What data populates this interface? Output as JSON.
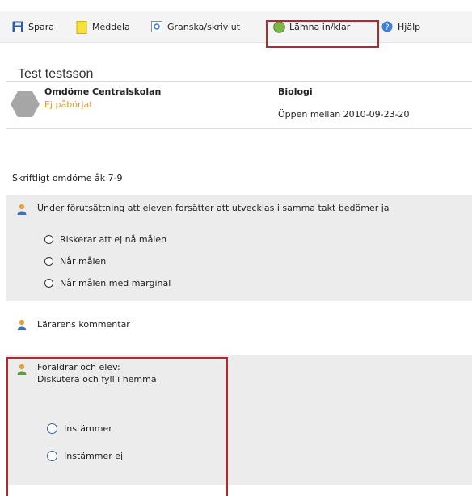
{
  "toolbar": {
    "save_label": "Spara",
    "notify_label": "Meddela",
    "review_label": "Granska/skriv ut",
    "submit_label": "Lämna in/klar",
    "help_label": "Hjälp"
  },
  "student": {
    "name": "Test testsson"
  },
  "assessment": {
    "title": "Omdöme Centralskolan",
    "status": "Ej påbörjat",
    "subject": "Biologi",
    "open_period": "Öppen mellan 2010-09-23-20"
  },
  "section": {
    "title": "Skriftligt omdöme åk 7-9"
  },
  "question": {
    "text": "Under förutsättning att eleven forsätter att utvecklas i samma takt bedömer ja",
    "options": [
      "Riskerar att ej nå målen",
      "Når målen",
      "Når målen med marginal"
    ]
  },
  "teacher_comment": {
    "label": "Lärarens kommentar"
  },
  "parents": {
    "line1": "Föräldrar och elev:",
    "line2": "Diskutera och fyll i hemma",
    "options": [
      "Instämmer",
      "Instämmer ej"
    ]
  },
  "colors": {
    "status": "#e19a2f",
    "highlight": "#b3282e",
    "panel": "#ececec"
  }
}
